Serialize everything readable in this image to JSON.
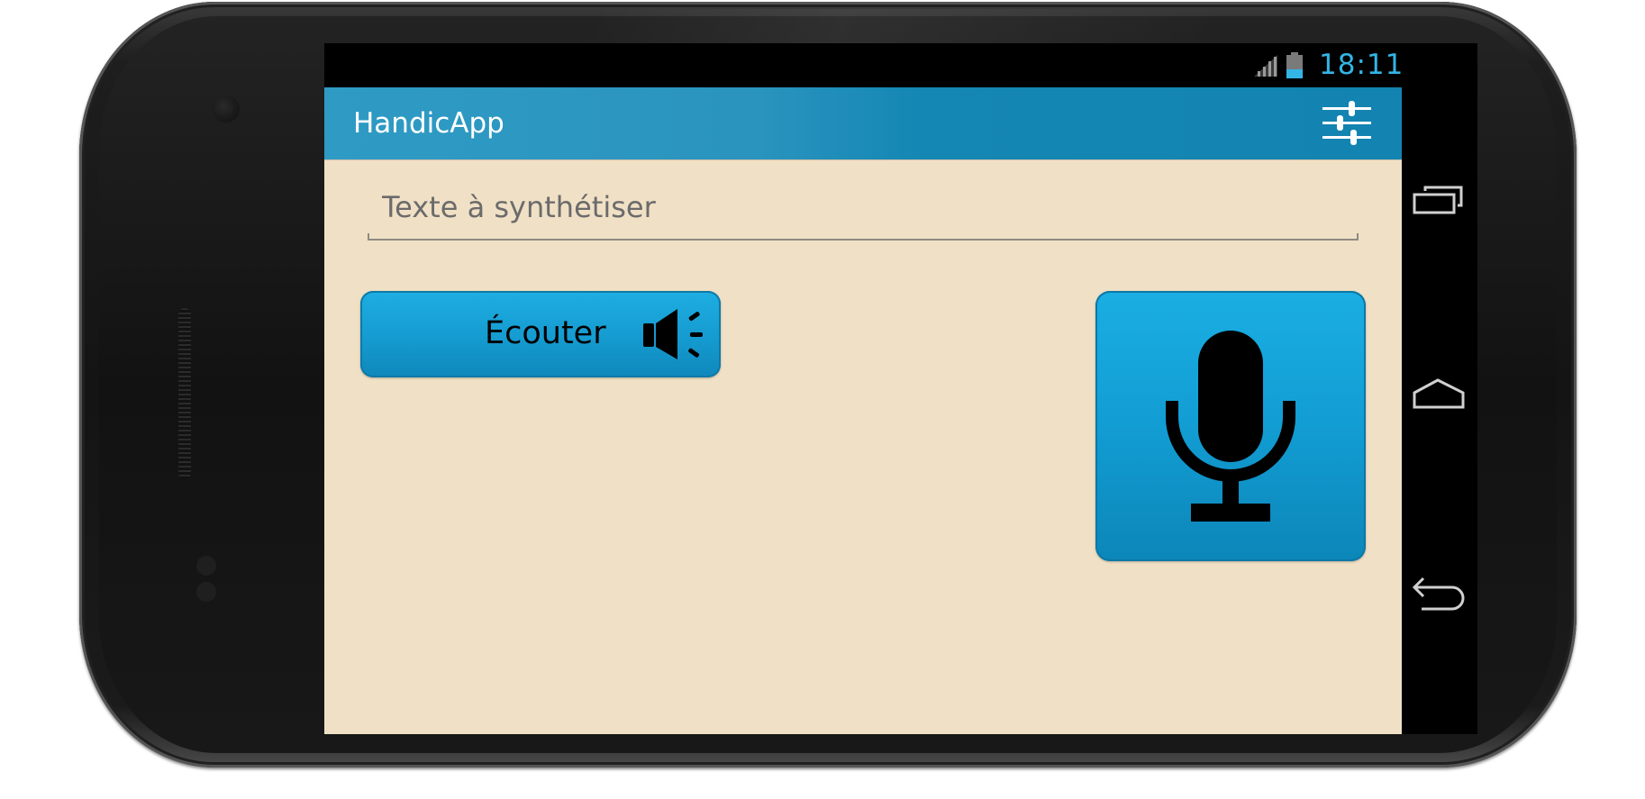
{
  "status_bar": {
    "time": "18:11",
    "signal_icon": "cell-signal-icon",
    "battery_icon": "battery-icon"
  },
  "action_bar": {
    "title": "HandicApp",
    "settings_icon": "sliders-icon"
  },
  "text_input": {
    "placeholder": "Texte à synthétiser",
    "value": ""
  },
  "listen_button": {
    "label": "Écouter",
    "icon": "speaker-icon"
  },
  "mic_button": {
    "icon": "microphone-icon"
  },
  "nav_bar": {
    "recents_icon": "recent-apps-icon",
    "home_icon": "home-icon",
    "back_icon": "back-icon"
  },
  "colors": {
    "accent": "#33b5e5",
    "action_bar": "#1384b2",
    "background": "#f0e0c5",
    "button": "#159bd0"
  }
}
